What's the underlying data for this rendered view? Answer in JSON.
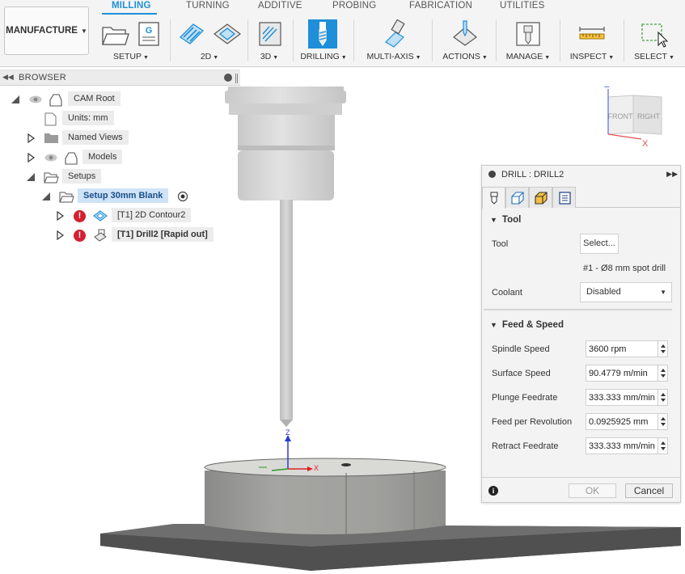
{
  "workspace": {
    "label": "MANUFACTURE"
  },
  "tabs": [
    "MILLING",
    "TURNING",
    "ADDITIVE",
    "PROBING",
    "FABRICATION",
    "UTILITIES"
  ],
  "active_tab": "MILLING",
  "toolbar_groups": [
    {
      "label": "SETUP",
      "icons": [
        "setup-folder-icon",
        "nc-program-icon"
      ]
    },
    {
      "label": "2D",
      "icons": [
        "2d-adaptive-icon",
        "2d-pocket-icon"
      ]
    },
    {
      "label": "3D",
      "icons": [
        "3d-adaptive-icon"
      ]
    },
    {
      "label": "DRILLING",
      "icons": [
        "drill-icon"
      ]
    },
    {
      "label": "MULTI-AXIS",
      "icons": [
        "multi-axis-icon"
      ]
    },
    {
      "label": "ACTIONS",
      "icons": [
        "simulate-icon"
      ]
    },
    {
      "label": "MANAGE",
      "icons": [
        "tool-library-icon"
      ]
    },
    {
      "label": "INSPECT",
      "icons": [
        "measure-icon"
      ]
    },
    {
      "label": "SELECT",
      "icons": [
        "select-window-icon"
      ]
    }
  ],
  "browser": {
    "title": "BROWSER",
    "items": [
      {
        "label": "CAM Root"
      },
      {
        "label": "Units: mm"
      },
      {
        "label": "Named Views"
      },
      {
        "label": "Models"
      },
      {
        "label": "Setups"
      },
      {
        "label": "Setup 30mm Blank"
      },
      {
        "label": "[T1] 2D Contour2"
      },
      {
        "label": "[T1] Drill2 [Rapid out]"
      }
    ]
  },
  "viewcube": {
    "front": "FRONT",
    "right": "RIGHT",
    "z": "Z",
    "x": "X"
  },
  "triad": {
    "z": "Z",
    "x": "X"
  },
  "colors": {
    "accent": "#1e8fd8",
    "error": "#d32030",
    "selected_bg": "#cfe3f7"
  },
  "panel": {
    "title": "DRILL : DRILL2",
    "tabs": [
      "tool-tab-icon",
      "geometry-tab-icon",
      "heights-tab-icon",
      "cycle-tab-icon"
    ],
    "tool_section": {
      "title": "Tool",
      "tool_label": "Tool",
      "select_label": "Select...",
      "tool_desc": "#1 - Ø8 mm spot drill",
      "coolant_label": "Coolant",
      "coolant_value": "Disabled"
    },
    "feed_section": {
      "title": "Feed & Speed",
      "fields": [
        {
          "label": "Spindle Speed",
          "value": "3600 rpm"
        },
        {
          "label": "Surface Speed",
          "value": "90.4779 m/min"
        },
        {
          "label": "Plunge Feedrate",
          "value": "333.333 mm/min"
        },
        {
          "label": "Feed per Revolution",
          "value": "0.0925925 mm"
        },
        {
          "label": "Retract Feedrate",
          "value": "333.333 mm/min"
        }
      ]
    },
    "ok_label": "OK",
    "cancel_label": "Cancel"
  }
}
